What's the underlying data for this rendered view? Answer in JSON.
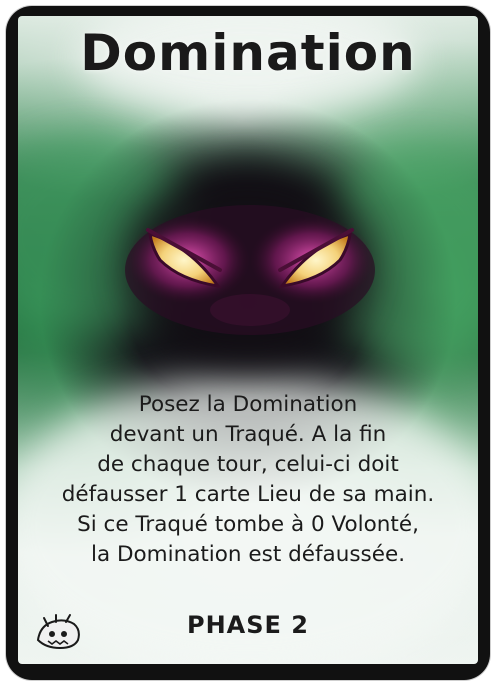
{
  "card": {
    "title": "Domination",
    "rules_lines": [
      "Posez la Domination",
      "devant un Traqué. A la fin",
      "de chaque tour, celui-ci doit",
      "défausser 1 carte Lieu de sa main.",
      "Si ce Traqué tombe à 0 Volonté,",
      "la Domination est défaussée."
    ],
    "phase_label": "PHASE 2",
    "colors": {
      "frame": "#111111",
      "mist_green": "#2e8a4e",
      "mist_light": "#eef4f0",
      "eye_glow": "#f4d27a",
      "eye_aura": "#a0207a"
    },
    "icons": {
      "artwork": "glowing-eyes-icon",
      "faction": "creature-icon"
    }
  }
}
